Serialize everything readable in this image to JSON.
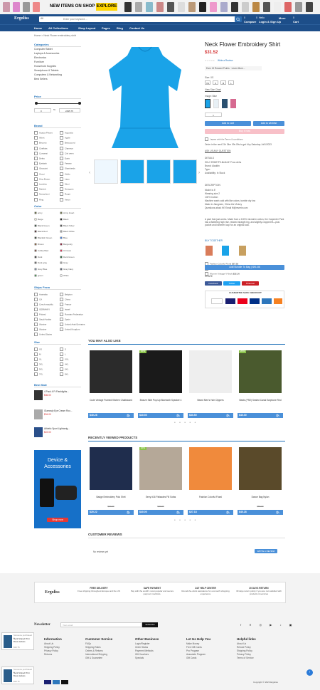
{
  "banner": {
    "text": "NEW ITEMS ON SHOP",
    "button": "EXPLORE"
  },
  "header": {
    "logo": "Ergoliss",
    "search_category": "All",
    "search_placeholder": "Enter your keyword ...",
    "compare": {
      "top": "0",
      "bottom": "Compare"
    },
    "wishlist": {
      "top": "0",
      "bottom": "Wishlist"
    },
    "account": {
      "top": "Hello",
      "bottom": "Login & Sign Up"
    },
    "more": {
      "top": "",
      "bottom": "More"
    },
    "cart": {
      "top": "0",
      "bottom": "Cart"
    }
  },
  "nav": [
    "Home",
    "All Collections",
    "Shop Layout",
    "Pages",
    "Blog",
    "Contact Us"
  ],
  "breadcrumb": "Home  >  Neck Flower embroidery shirt",
  "categories": {
    "title": "Categories",
    "items": [
      "Computer/Tablet",
      "Laptops & Accessories",
      "Electronics",
      "Furniture",
      "Household Supplies",
      "Smartphone & Tablets",
      "Computers & Networking",
      "Best Sellers"
    ]
  },
  "price": {
    "title": "Price",
    "min": "0",
    "max": "2495.75",
    "to": "To"
  },
  "brand": {
    "title": "Brand",
    "col1": [
      "Acacia Pieces",
      "Allnet",
      "Beoorto",
      "Chefkiss",
      "Conversi",
      "Deleu",
      "Eyelash",
      "Gbovotni",
      "Gucci",
      "King Brown",
      "Lauletta",
      "Matrink",
      "Nanophoni",
      "Ring"
    ],
    "col2": [
      "Acquista",
      "Apple",
      "Beaucourd",
      "Clameos",
      "Cinl veen",
      "Euris",
      "Fewew",
      "Glamberds",
      "Kiddo",
      "Lapo",
      "Moni",
      "Newgoes",
      "Roger",
      "Veron"
    ]
  },
  "color": {
    "title": "Color",
    "col1": [
      {
        "n": "army",
        "c": "#4b5320"
      },
      {
        "n": "Beige",
        "c": "#f5f5dc"
      },
      {
        "n": "Black Green",
        "c": "#1f3b2a"
      },
      {
        "n": "Black Red",
        "c": "#3a1010"
      },
      {
        "n": "Blackish Green",
        "c": "#203020"
      },
      {
        "n": "Brown",
        "c": "#7b4a24"
      },
      {
        "n": "Coffee/Red",
        "c": "#6f3b2a"
      },
      {
        "n": "Dark",
        "c": "#222222"
      },
      {
        "n": "Dark gray",
        "c": "#555555"
      },
      {
        "n": "Grey Blue",
        "c": "#6e7f99"
      },
      {
        "n": "green",
        "c": "#2e8b3a"
      }
    ],
    "col2": [
      {
        "n": "Army Insert",
        "c": "#5a6133"
      },
      {
        "n": "Black",
        "c": "#000000"
      },
      {
        "n": "Black Silver",
        "c": "#3a3a3a"
      },
      {
        "n": "Black White",
        "c": "#999999"
      },
      {
        "n": "Blue",
        "c": "#2f6fd6"
      },
      {
        "n": "Burgundy",
        "c": "#800020"
      },
      {
        "n": "Crimson",
        "c": "#dc143c"
      },
      {
        "n": "Dark Green",
        "c": "#0f4d20"
      },
      {
        "n": "Gray",
        "c": "#9a9a9a"
      },
      {
        "n": "Gray Navy",
        "c": "#445063"
      },
      {
        "n": "White",
        "c": "#ffffff"
      }
    ]
  },
  "ships": {
    "title": "Ships From",
    "col1": [
      "Australia",
      "CA",
      "Czech republic",
      "GERMANY",
      "Poland",
      "Saudi Arabia",
      "Ukraine",
      "Ukraine",
      "United States"
    ],
    "col2": [
      "Belgium",
      "China",
      "France",
      "Israel",
      "Russian Federation",
      "Spain",
      "United Arab Emirates",
      "United Kingdom"
    ]
  },
  "size": {
    "title": "Size",
    "col1": [
      "XS",
      "M",
      "XL",
      "3XL",
      "5XL",
      "7XL"
    ],
    "col2": [
      "S",
      "L",
      "XXL",
      "4XL",
      "6XL",
      "8XL"
    ]
  },
  "best_seller": {
    "title": "Best Sale",
    "items": [
      {
        "name": "4 Pack 4 Ft Flashlights...",
        "price": "$36.00"
      },
      {
        "name": "Glamosly Eye Cream Roo...",
        "price": "$34.00"
      },
      {
        "name": "Athletic Sport Lightweig...",
        "price": "$22.00"
      }
    ]
  },
  "ad": {
    "title": "Device & Accessories",
    "button": "Shop now"
  },
  "product": {
    "title": "Neck Flower Embroidery Shirt",
    "price": "$31.52",
    "review": "Write a Review",
    "rewards": "Earn 13 Reward Points · Learn More...",
    "size_label": "Size: XS",
    "sizes": [
      "XS",
      "S",
      "M",
      "L"
    ],
    "size_chart": "View Size Chart",
    "image_label": "Image: Blue",
    "qty": "1",
    "add_cart": "Add to cart",
    "add_wish": "Add to wishlist",
    "buy_now": "Buy it now",
    "terms": "I agree with the Terms & conditions",
    "order_time": "Order in the next 21h 34m 09s 09s to get it by Saturday Jul/1/2023",
    "ask": "ASK US ANY QUESTION",
    "details_title": "DETAILS",
    "details": [
      "SKU: 993527F9-6b4b4177-kcr-dehs",
      "Brand: Aladdin",
      "Type:",
      "Availability: In Stock"
    ],
    "desc_title": "DESCRIPTION",
    "desc_list": [
      "Model is 5'",
      "Wearing size 2",
      "100% Cotton",
      "Machine wash cold with like colors, tumble dry low",
      "Made in Jiangmen, China the Victory",
      "Questions about fit? Email fit@reverie.com"
    ],
    "desc_para": "A pant that just works. Made from a 100% microtrim cotton, the Carpenter Pant has a flattering high rise, relaxed straight leg, and slightly cropped fit—plus pocket and hammer loop for an original look.",
    "buy_together": "BUY TOGETHER",
    "bundle": [
      {
        "name": "Fashion Colorful Floral",
        "price": "$27.18"
      },
      {
        "name": "Neck Flower embroidery shirt",
        "price": "$31.52"
      },
      {
        "name": "Women Vintage V-Neck",
        "price": "$32.16"
      }
    ],
    "bundle_btn": "Add Bundle To Bag  |  $91.86",
    "share": "SHARE",
    "share_buttons": [
      {
        "n": "Facebook",
        "c": "#3b5998"
      },
      {
        "n": "Twitter",
        "c": "#1da1f2"
      },
      {
        "n": "Pinterest",
        "c": "#cb2027"
      }
    ],
    "guarantee": "GUARANTEE SAFE CHECKOUT"
  },
  "may_like": {
    "title": "YOU MAY ALSO LIKE",
    "items": [
      {
        "name": "Cude Vintage Framed Kitchen Chalkboard",
        "price": "$40.28",
        "badge": ""
      },
      {
        "name": "Bronze Skirt Pop-Up Bluetooth Speaker 4",
        "price": "$40.50",
        "badge": "20%"
      },
      {
        "name": "Beard Men's Hair Clippers",
        "price": "$30.50",
        "badge": ""
      },
      {
        "name": "Beats (PSE) Sealed Canal Earphone Red",
        "price": "$40.00",
        "badge": "20%"
      }
    ]
  },
  "recent": {
    "title": "RECENTLY VIEWED PRODUCTS",
    "items": [
      {
        "name": "Badge Embroidery Polo Shirt",
        "price": "$20.22",
        "old": "$30.00",
        "badge": ""
      },
      {
        "name": "Serry #16 Palisades Fill Sofas",
        "price": "$40.00",
        "old": "$40.00",
        "badge": "20%"
      },
      {
        "name": "Fashion Colorful Floral",
        "price": "$27.18",
        "old": "",
        "badge": ""
      },
      {
        "name": "Dance Bag Nylon",
        "price": "$40.28",
        "old": "$50.00",
        "badge": ""
      }
    ]
  },
  "reviews": {
    "title": "CUSTOMER REVIEWS",
    "empty": "No reviews yet",
    "button": "WRITE A REVIEW"
  },
  "footer": {
    "logo": "Ergoliss",
    "features": [
      {
        "t": "FREE DELIVERY",
        "d": "Free shipping throughout Europe and the US"
      },
      {
        "t": "SAFE PAYMENT",
        "d": "Pay with the world's most popular and secure payment methods."
      },
      {
        "t": "24/7 HELP CENTER",
        "d": "Round-the-clock assistance for a smooth shopping experience"
      },
      {
        "t": "30 DAYS RETURN",
        "d": "30 days return policy if you are not satisfied with products & services"
      }
    ],
    "newsletter": "Newsletter",
    "email_placeholder": "Your email",
    "subscribe": "Subscribe",
    "cols": [
      {
        "t": "Information",
        "i": [
          "About Us",
          "Shipping Policy",
          "Privacy Policy",
          "Returns"
        ]
      },
      {
        "t": "Customer Service",
        "i": [
          "FAQs",
          "Shipping Rates",
          "Orders & Returns",
          "International Shipping",
          "Gift & Guarantee"
        ]
      },
      {
        "t": "Other Business",
        "i": [
          "Login/Register",
          "Order Status",
          "Payment Methods",
          "Gift Vouchers",
          "Specials"
        ]
      },
      {
        "t": "Let Us Help You",
        "i": [
          "Make Money",
          "Free Gift Cards",
          "Pro Program",
          "Associate Program",
          "Gift Cards"
        ]
      },
      {
        "t": "Helpful links",
        "i": [
          "About Us",
          "Refund Policy",
          "Shipping Policy",
          "Privacy Policy",
          "Terms of Service"
        ]
      }
    ],
    "copyright": "Copyright © 2023  Ergoliss",
    "popup": {
      "line": "Someone purchased a",
      "name": "Neck Striped Print Boss Jackets",
      "price": "$33.75"
    }
  }
}
